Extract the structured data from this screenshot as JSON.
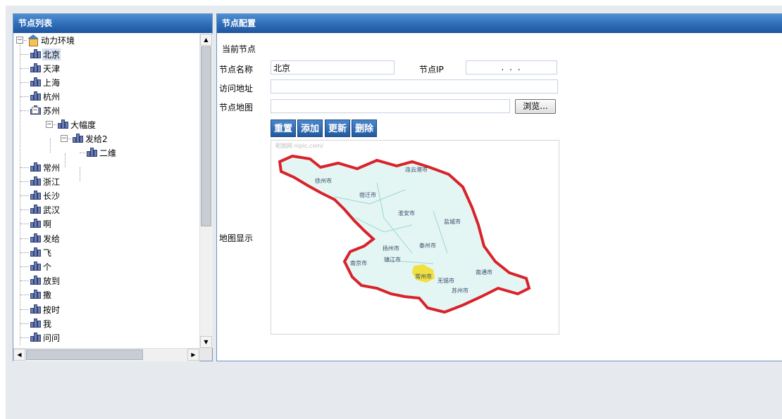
{
  "left_panel": {
    "title": "节点列表",
    "tree": [
      {
        "label": "动力环境",
        "kind": "root",
        "expanded": true
      },
      {
        "label": "北京",
        "selected": true
      },
      {
        "label": "天津"
      },
      {
        "label": "上海"
      },
      {
        "label": "杭州"
      },
      {
        "label": "苏州",
        "expanded": true
      },
      {
        "label": "大幅度",
        "expanded": true
      },
      {
        "label": "发给2",
        "expanded": true
      },
      {
        "label": "二维"
      },
      {
        "label": "常州"
      },
      {
        "label": "浙江"
      },
      {
        "label": "长沙"
      },
      {
        "label": "武汉"
      },
      {
        "label": "啊"
      },
      {
        "label": "发给"
      },
      {
        "label": "飞"
      },
      {
        "label": "个"
      },
      {
        "label": "放到"
      },
      {
        "label": "撒"
      },
      {
        "label": "按时"
      },
      {
        "label": "我"
      },
      {
        "label": "问问"
      }
    ],
    "expander_minus": "−",
    "scroll_up": "▲",
    "scroll_down": "▼",
    "scroll_left": "◀",
    "scroll_right": "▶"
  },
  "right_panel": {
    "title": "节点配置",
    "current_node_label": "当前节点",
    "node_name_label": "节点名称",
    "node_name_value": "北京",
    "node_ip_label": "节点IP",
    "node_ip_value": ". . .",
    "access_url_label": "访问地址",
    "access_url_value": "",
    "node_map_label": "节点地图",
    "node_map_value": "",
    "browse_label": "浏览...",
    "buttons": {
      "reset": "重置",
      "add": "添加",
      "update": "更新",
      "delete": "删除"
    },
    "map_display_label": "地图显示",
    "map": {
      "watermark": "昵图网 nipic.com/",
      "cities": [
        "连云港市",
        "徐州市",
        "宿迁市",
        "淮安市",
        "盐城市",
        "扬州市",
        "泰州市",
        "南京市",
        "镇江市",
        "常州市",
        "南通市",
        "无锡市",
        "苏州市"
      ],
      "highlight_color": "#f0e040",
      "border_color": "#d8232a",
      "fill_color": "#e4f6f4"
    }
  },
  "colors": {
    "header_blue": "#2f6cb7",
    "button_blue": "#21599f",
    "page_bg": "#e6eaef"
  }
}
